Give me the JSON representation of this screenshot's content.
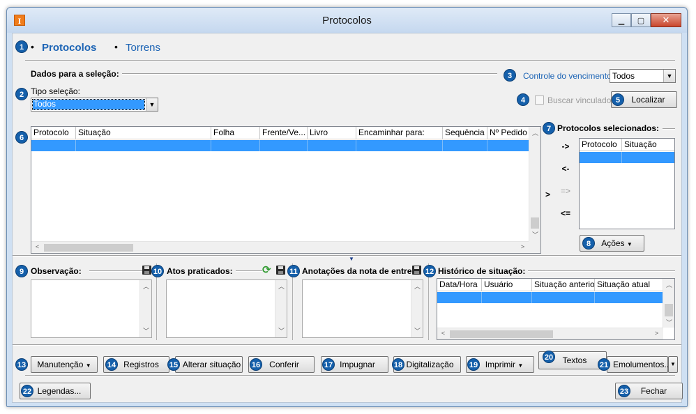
{
  "window": {
    "title": "Protocolos",
    "app_icon": "I"
  },
  "tabs": [
    {
      "label": "Protocolos",
      "active": true
    },
    {
      "label": "Torrens",
      "active": false
    }
  ],
  "selection": {
    "group_label": "Dados para a seleção:",
    "tipo_label": "Tipo seleção:",
    "tipo_value": "Todos",
    "controle_label": "Controle do vencimento",
    "controle_value": "Todos",
    "buscar_label": "Buscar vinculados",
    "localizar_label": "Localizar"
  },
  "main_grid": {
    "columns": [
      "Protocolo",
      "Situação",
      "Folha",
      "Frente/Ve...",
      "Livro",
      "Encaminhar para:",
      "Sequência",
      "Nº Pedido"
    ]
  },
  "selected": {
    "group_label": "Protocolos selecionados:",
    "columns": [
      "Protocolo",
      "Situação"
    ],
    "move_buttons": [
      "->",
      "<-",
      "=>",
      "<="
    ],
    "cursor": ">",
    "acoes_label": "Ações"
  },
  "panels": {
    "observacao": "Observação:",
    "atos": "Atos praticados:",
    "anotacoes": "Anotações da nota de entre",
    "historico": "Histórico de situação:",
    "historico_columns": [
      "Data/Hora",
      "Usuário",
      "Situação anterior",
      "Situação atual"
    ]
  },
  "toolbar": {
    "manutencao": "Manutenção",
    "registros": "Registros",
    "alterar": "Alterar situação",
    "conferir": "Conferir",
    "impugnar": "Impugnar",
    "digitalizacao": "Digitalização",
    "imprimir": "Imprimir",
    "textos": "Textos",
    "emolumentos": "Emolumentos..."
  },
  "footer": {
    "legendas": "Legendas...",
    "fechar": "Fechar"
  },
  "badges": [
    "1",
    "2",
    "3",
    "4",
    "5",
    "6",
    "7",
    "8",
    "9",
    "10",
    "11",
    "12",
    "13",
    "14",
    "15",
    "16",
    "17",
    "18",
    "19",
    "20",
    "21",
    "22",
    "23"
  ],
  "colors": {
    "accent": "#1560ab",
    "link": "#1c64b5",
    "selection": "#3399ff",
    "background": "#f0f0f0"
  }
}
